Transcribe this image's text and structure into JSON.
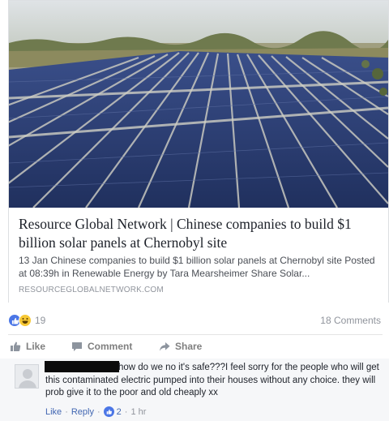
{
  "link_card": {
    "title": "Resource Global Network | Chinese companies to build $1 billion solar panels at Chernobyl site",
    "description": "13 Jan Chinese companies to build $1 billion solar panels at Chernobyl site Posted at 08:39h in Renewable Energy by Tara Mearsheimer Share Solar...",
    "domain": "RESOURCEGLOBALNETWORK.COM"
  },
  "stats": {
    "reaction_icons": [
      "like-icon",
      "haha-icon"
    ],
    "reactions_count": "19",
    "comments_count": "18 Comments"
  },
  "actions": {
    "like_label": "Like",
    "comment_label": "Comment",
    "share_label": "Share"
  },
  "comment": {
    "text": "how do we no it's safe???I feel sorry for the people who will get this contaminated electric pumped into their houses without any choice. they will prob give it to the poor and old cheaply xx",
    "like_label": "Like",
    "reply_label": "Reply",
    "likes_count": "2",
    "time": "1 hr"
  },
  "colors": {
    "accent": "#4267b2",
    "like_blue": "#4b76e6",
    "haha_yellow": "#f7c835",
    "muted": "#90949c"
  }
}
